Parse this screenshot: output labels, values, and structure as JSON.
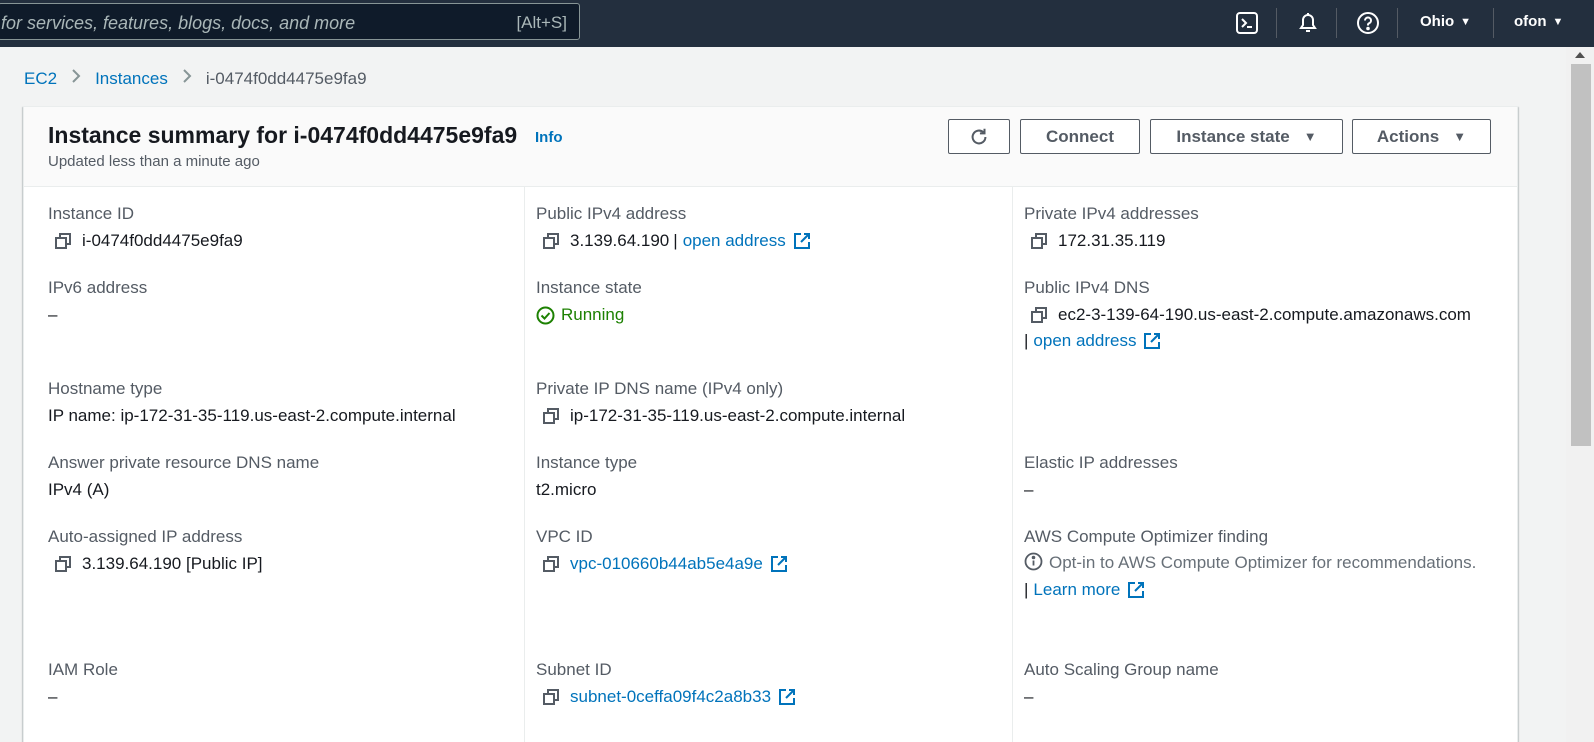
{
  "topbar": {
    "search_placeholder": "for services, features, blogs, docs, and more",
    "search_shortcut": "[Alt+S]",
    "region": "Ohio",
    "user": "ofon"
  },
  "breadcrumb": {
    "items": [
      "EC2",
      "Instances"
    ],
    "current": "i-0474f0dd4475e9fa9"
  },
  "summary": {
    "title": "Instance summary for i-0474f0dd4475e9fa9",
    "info": "Info",
    "subtitle": "Updated less than a minute ago",
    "buttons": {
      "connect": "Connect",
      "instance_state": "Instance state",
      "actions": "Actions"
    }
  },
  "fields": {
    "instance_id": {
      "label": "Instance ID",
      "value": "i-0474f0dd4475e9fa9"
    },
    "public_ipv4": {
      "label": "Public IPv4 address",
      "value": "3.139.64.190",
      "link": "open address"
    },
    "private_ipv4": {
      "label": "Private IPv4 addresses",
      "value": "172.31.35.119"
    },
    "ipv6": {
      "label": "IPv6 address",
      "value": "–"
    },
    "instance_state": {
      "label": "Instance state",
      "value": "Running"
    },
    "public_dns": {
      "label": "Public IPv4 DNS",
      "value": "ec2-3-139-64-190.us-east-2.compute.amazonaws.com",
      "link": "open address"
    },
    "hostname_type": {
      "label": "Hostname type",
      "value": "IP name: ip-172-31-35-119.us-east-2.compute.internal"
    },
    "private_dns": {
      "label": "Private IP DNS name (IPv4 only)",
      "value": "ip-172-31-35-119.us-east-2.compute.internal"
    },
    "answer_dns": {
      "label": "Answer private resource DNS name",
      "value": "IPv4 (A)"
    },
    "instance_type": {
      "label": "Instance type",
      "value": "t2.micro"
    },
    "elastic_ip": {
      "label": "Elastic IP addresses",
      "value": "–"
    },
    "auto_ip": {
      "label": "Auto-assigned IP address",
      "value": "3.139.64.190 [Public IP]"
    },
    "vpc_id": {
      "label": "VPC ID",
      "value": "vpc-010660b44ab5e4a9e"
    },
    "optimizer": {
      "label": "AWS Compute Optimizer finding",
      "value": "Opt-in to AWS Compute Optimizer for recommendations.",
      "link": "Learn more"
    },
    "iam_role": {
      "label": "IAM Role",
      "value": "–"
    },
    "subnet_id": {
      "label": "Subnet ID",
      "value": "subnet-0ceffa09f4c2a8b33"
    },
    "asg_name": {
      "label": "Auto Scaling Group name",
      "value": "–"
    }
  },
  "colors": {
    "topbar": "#232f3e",
    "link": "#0073bb",
    "running": "#1d8102"
  }
}
